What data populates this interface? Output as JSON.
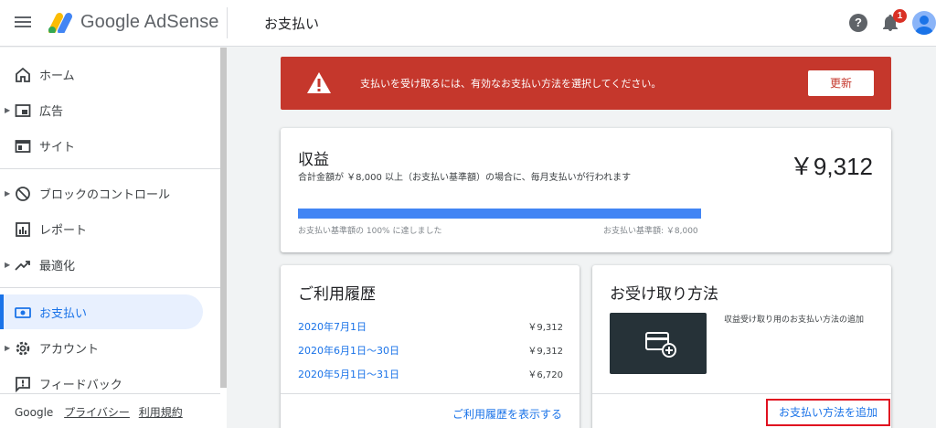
{
  "header": {
    "brand": "Google AdSense",
    "title": "お支払い",
    "notification_count": "1",
    "help_glyph": "?"
  },
  "sidebar": {
    "items": [
      {
        "label": "ホーム",
        "icon": "home-icon"
      },
      {
        "label": "広告",
        "icon": "ads-icon"
      },
      {
        "label": "サイト",
        "icon": "sites-icon"
      },
      {
        "label": "ブロックのコントロール",
        "icon": "block-icon"
      },
      {
        "label": "レポート",
        "icon": "reports-icon"
      },
      {
        "label": "最適化",
        "icon": "optimize-icon"
      },
      {
        "label": "お支払い",
        "icon": "payments-icon"
      },
      {
        "label": "アカウント",
        "icon": "account-icon"
      },
      {
        "label": "フィードバック",
        "icon": "feedback-icon"
      }
    ],
    "footer": {
      "google": "Google",
      "privacy": "プライバシー",
      "terms": "利用規約"
    }
  },
  "alert": {
    "message": "支払いを受け取るには、有効なお支払い方法を選択してください。",
    "button": "更新"
  },
  "earnings": {
    "title": "収益",
    "description": "合計金額が ￥8,000 以上（お支払い基準額）の場合に、毎月支払いが行われます",
    "amount": "￥9,312",
    "progress_fraction": 1.0,
    "progress_left": "お支払い基準額の 100% に達しました",
    "progress_right": "お支払い基準額: ￥8,000"
  },
  "history": {
    "title": "ご利用履歴",
    "rows": [
      {
        "period": "2020年7月1日",
        "amount": "￥9,312"
      },
      {
        "period": "2020年6月1日～30日",
        "amount": "￥9,312"
      },
      {
        "period": "2020年5月1日～31日",
        "amount": "￥6,720"
      }
    ],
    "link": "ご利用履歴を表示する"
  },
  "receive": {
    "title": "お受け取り方法",
    "description": "収益受け取り用のお支払い方法の追加",
    "button": "お支払い方法を追加"
  },
  "colors": {
    "accent": "#1a73e8",
    "alert_bg": "#c5372c",
    "progress": "#4285f4",
    "highlight_border": "#e01020"
  }
}
